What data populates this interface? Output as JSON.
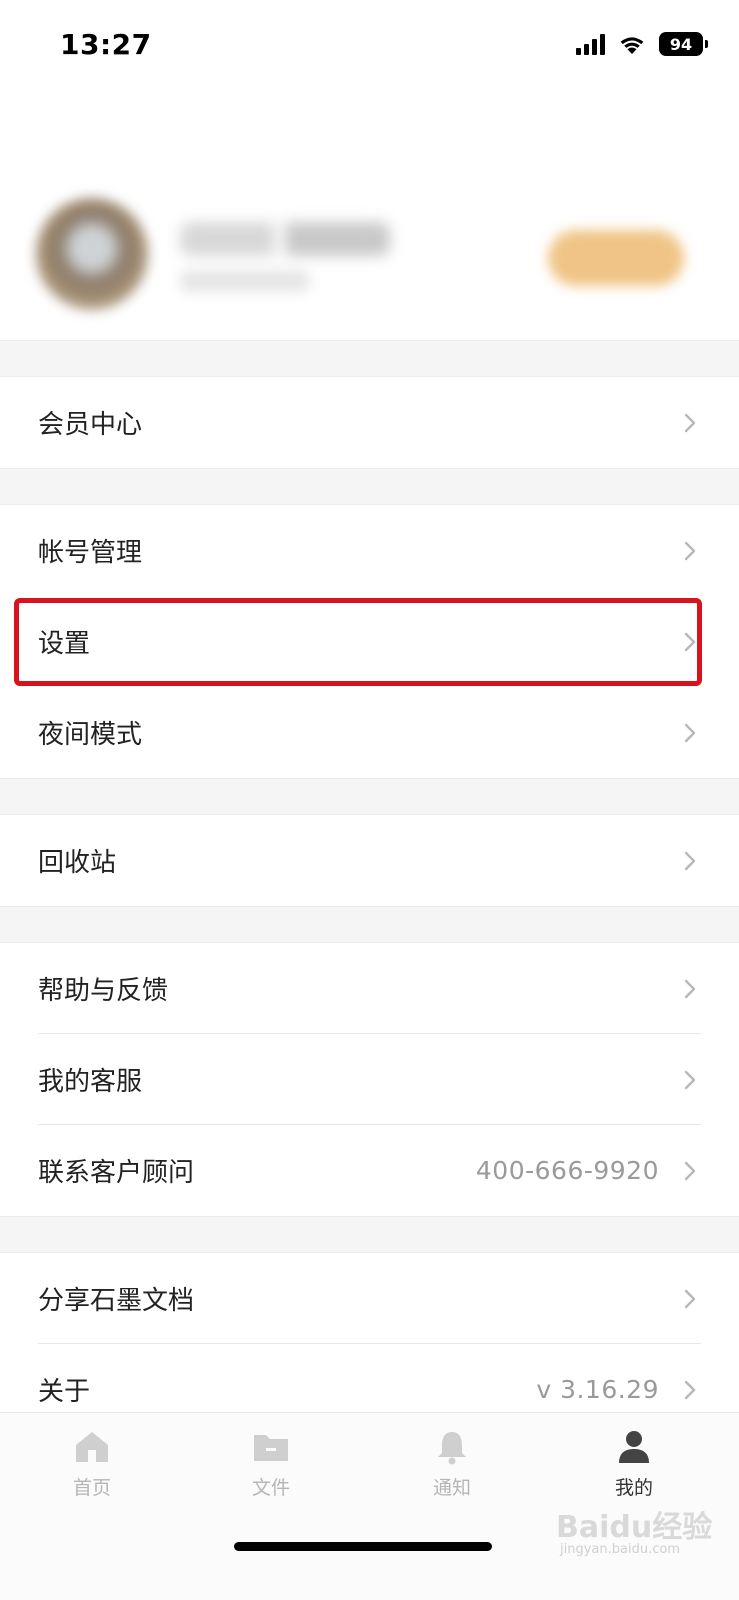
{
  "status_bar": {
    "time": "13:27",
    "battery": "94"
  },
  "menu": {
    "member_center": "会员中心",
    "account_management": "帐号管理",
    "settings": "设置",
    "night_mode": "夜间模式",
    "recycle_bin": "回收站",
    "help_feedback": "帮助与反馈",
    "my_customer_service": "我的客服",
    "contact_advisor": "联系客户顾问",
    "contact_advisor_phone": "400-666-9920",
    "share_shimo": "分享石墨文档",
    "about": "关于",
    "about_version": "v 3.16.29"
  },
  "tabs": [
    {
      "label": "首页",
      "icon": "home-icon"
    },
    {
      "label": "文件",
      "icon": "folder-icon"
    },
    {
      "label": "通知",
      "icon": "bell-icon"
    },
    {
      "label": "我的",
      "icon": "person-icon"
    }
  ],
  "watermark": {
    "brand": "Baidu经验",
    "site": "jingyan.baidu.com"
  },
  "colors": {
    "highlight": "#d9131d",
    "active_tab": "#333333",
    "inactive_tab": "#b5b5b5",
    "secondary_text": "#9a9a9a"
  }
}
